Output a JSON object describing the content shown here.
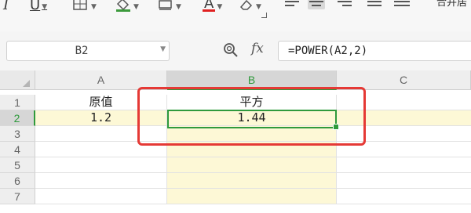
{
  "ribbon": {
    "italic_label": "I",
    "underline_label": "U",
    "font_color_label": "A",
    "merge_label": "合并居"
  },
  "formula_bar": {
    "name_box": "B2",
    "fx_label": "fx",
    "formula": "=POWER(A2,2)"
  },
  "grid": {
    "columns": [
      "A",
      "B",
      "C"
    ],
    "rows": [
      "1",
      "2",
      "3",
      "4",
      "5",
      "6",
      "7"
    ],
    "cells": {
      "A1": "原值",
      "B1": "平方",
      "A2": "1.2",
      "B2": "1.44"
    },
    "active_cell": "B2"
  },
  "colors": {
    "accent": "#2f9a3c",
    "highlight_row": "#fdf8d6",
    "annotation": "#e53935",
    "font_color_bar": "#e02020"
  }
}
